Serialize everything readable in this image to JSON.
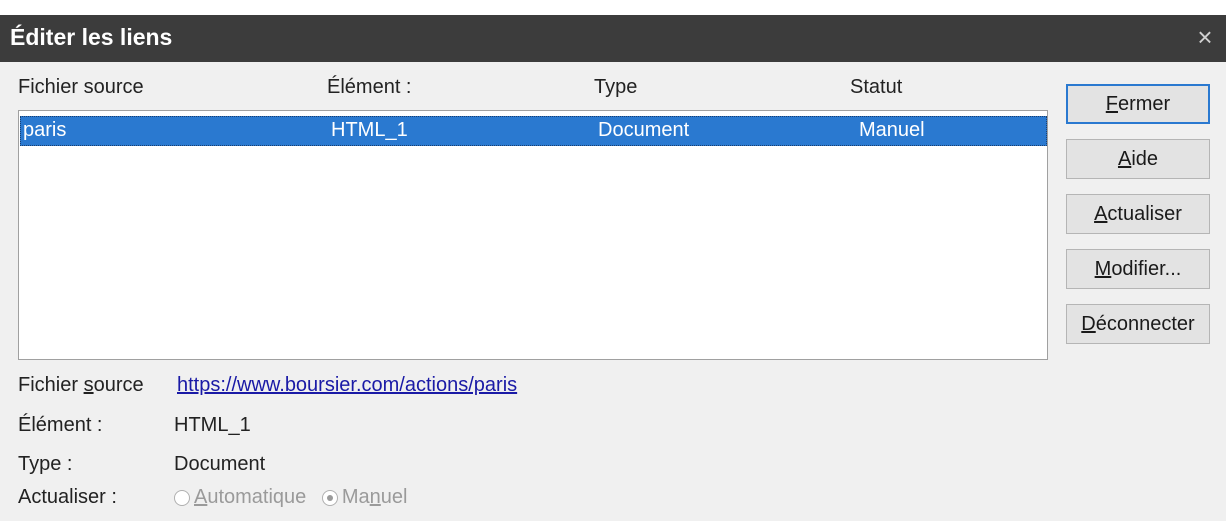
{
  "dialog": {
    "title": "Éditer les liens",
    "close_glyph": "×"
  },
  "table": {
    "columns": [
      "Fichier source",
      "Élément :",
      "Type",
      "Statut"
    ],
    "rows": [
      {
        "source": "paris",
        "element": "HTML_1",
        "type": "Document",
        "status": "Manuel",
        "selected": true
      }
    ]
  },
  "buttons": {
    "fermer": {
      "mnemonic": "F",
      "rest": "ermer"
    },
    "aide": {
      "mnemonic": "A",
      "rest": "ide"
    },
    "actualiser": {
      "mnemonic": "A",
      "rest": "ctualiser"
    },
    "modifier": {
      "mnemonic": "M",
      "rest": "odifier..."
    },
    "deconnecter": {
      "mnemonic": "D",
      "rest": "éconnecter"
    }
  },
  "info": {
    "source_label_pre": "Fichier ",
    "source_label_mnemonic": "s",
    "source_label_post": "ource",
    "source_url": "https://www.boursier.com/actions/paris",
    "element_label": "Élément :",
    "element_value": "HTML_1",
    "type_label": "Type :",
    "type_value": "Document",
    "update_label": "Actualiser :"
  },
  "update_mode": {
    "automatic": {
      "mnemonic": "A",
      "rest": "utomatique",
      "checked": false
    },
    "manual": {
      "pre": "Ma",
      "mnemonic": "n",
      "post": "uel",
      "checked": true
    }
  },
  "colors": {
    "titlebar": "#3c3c3c",
    "selection": "#2a79d0",
    "link": "#1a1aa6"
  }
}
